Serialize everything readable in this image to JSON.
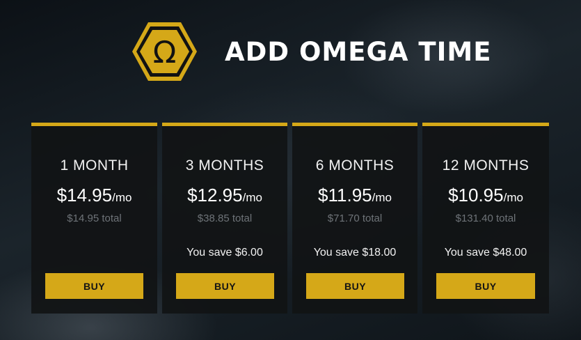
{
  "header": {
    "title": "ADD OMEGA TIME",
    "logo_icon": "omega-hexagon-icon",
    "accent_color": "#d5a818"
  },
  "plans": [
    {
      "name": "1 MONTH",
      "price": "$14.95",
      "per": "/mo",
      "total": "$14.95 total",
      "save": "",
      "buy_label": "BUY"
    },
    {
      "name": "3 MONTHS",
      "price": "$12.95",
      "per": "/mo",
      "total": "$38.85 total",
      "save": "You save $6.00",
      "buy_label": "BUY"
    },
    {
      "name": "6 MONTHS",
      "price": "$11.95",
      "per": "/mo",
      "total": "$71.70 total",
      "save": "You save $18.00",
      "buy_label": "BUY"
    },
    {
      "name": "12 MONTHS",
      "price": "$10.95",
      "per": "/mo",
      "total": "$131.40 total",
      "save": "You save $48.00",
      "buy_label": "BUY"
    }
  ]
}
